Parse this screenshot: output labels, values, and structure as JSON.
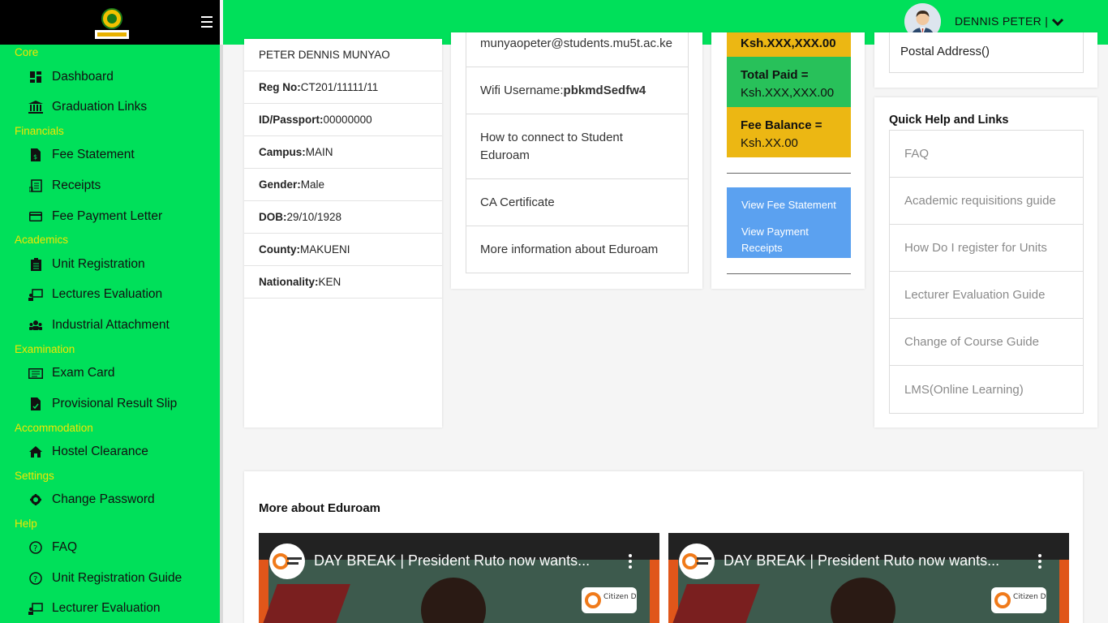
{
  "sidebar": {
    "sections": [
      {
        "title": "Core",
        "items": [
          {
            "label": "Dashboard",
            "icon": "dashboard-icon"
          },
          {
            "label": "Graduation Links",
            "icon": "university-icon"
          }
        ]
      },
      {
        "title": "Financials",
        "items": [
          {
            "label": "Fee Statement",
            "icon": "invoice-icon"
          },
          {
            "label": "Receipts",
            "icon": "receipt-icon"
          },
          {
            "label": "Fee Payment Letter",
            "icon": "credit-card-icon"
          }
        ]
      },
      {
        "title": "Academics",
        "items": [
          {
            "label": "Unit Registration",
            "icon": "clipboard-icon"
          },
          {
            "label": "Lectures Evaluation",
            "icon": "chalkboard-icon"
          },
          {
            "label": "Industrial Attachment",
            "icon": "users-icon"
          }
        ]
      },
      {
        "title": "Examination",
        "items": [
          {
            "label": "Exam Card",
            "icon": "id-card-icon"
          },
          {
            "label": "Provisional Result Slip",
            "icon": "file-icon"
          }
        ]
      },
      {
        "title": "Accommodation",
        "items": [
          {
            "label": "Hostel Clearance",
            "icon": "home-icon"
          }
        ]
      },
      {
        "title": "Settings",
        "items": [
          {
            "label": "Change Password",
            "icon": "gear-icon"
          }
        ]
      },
      {
        "title": "Help",
        "items": [
          {
            "label": "FAQ",
            "icon": "question-circle-icon"
          },
          {
            "label": "Unit Registration Guide",
            "icon": "question-circle-icon"
          },
          {
            "label": "Lecturer Evaluation",
            "icon": "chalkboard-icon"
          }
        ]
      }
    ]
  },
  "topbar": {
    "username": "DENNIS PETER |"
  },
  "profile": {
    "name": "PETER DENNIS MUNYAO",
    "fields": [
      {
        "label": "Reg No:",
        "value": "CT201/11111/11"
      },
      {
        "label": "ID/Passport:",
        "value": "00000000"
      },
      {
        "label": "Campus:",
        "value": "MAIN"
      },
      {
        "label": "Gender:",
        "value": "Male"
      },
      {
        "label": "DOB:",
        "value": "29/10/1928"
      },
      {
        "label": "County:",
        "value": "MAKUENI"
      },
      {
        "label": "Nationality:",
        "value": "KEN"
      }
    ]
  },
  "eduroam": {
    "email": "munyaopeter@students.mu5t.ac.ke",
    "wifi_label": "Wifi Username:",
    "wifi_value": "pbkmdSedfw4",
    "connect_link": "How to connect to Student Eduroam",
    "ca_link": "CA Certificate",
    "more_link": "More information about Eduroam"
  },
  "fees": {
    "top_partial": "Ksh.XXX,XXX.00",
    "paid_label": "Total Paid =",
    "paid_value": "Ksh.XXX,XXX.00",
    "balance_label": "Fee Balance =",
    "balance_value": "Ksh.XX.00",
    "view_statement": "View Fee Statement",
    "view_receipts": "View Payment Receipts"
  },
  "contact": {
    "postal": "Postal Address()"
  },
  "quick_help": {
    "title": "Quick Help and Links",
    "links": [
      "FAQ",
      "Academic requisitions guide",
      "How Do I register for Units",
      "Lecturer Evaluation Guide",
      "Change of Course Guide",
      "LMS(Online Learning)"
    ]
  },
  "more": {
    "title": "More about Eduroam",
    "videos": [
      {
        "title": "DAY BREAK | President Ruto now wants...",
        "channel_badge": "Citizen Digital"
      },
      {
        "title": "DAY BREAK | President Ruto now wants...",
        "channel_badge": "Citizen Digital"
      }
    ]
  },
  "colors": {
    "green": "#00e05a",
    "yellow": "#ecb713",
    "paid_green": "#28c15a",
    "blue": "#5ba1f0",
    "section_yellow": "#f2e600"
  }
}
